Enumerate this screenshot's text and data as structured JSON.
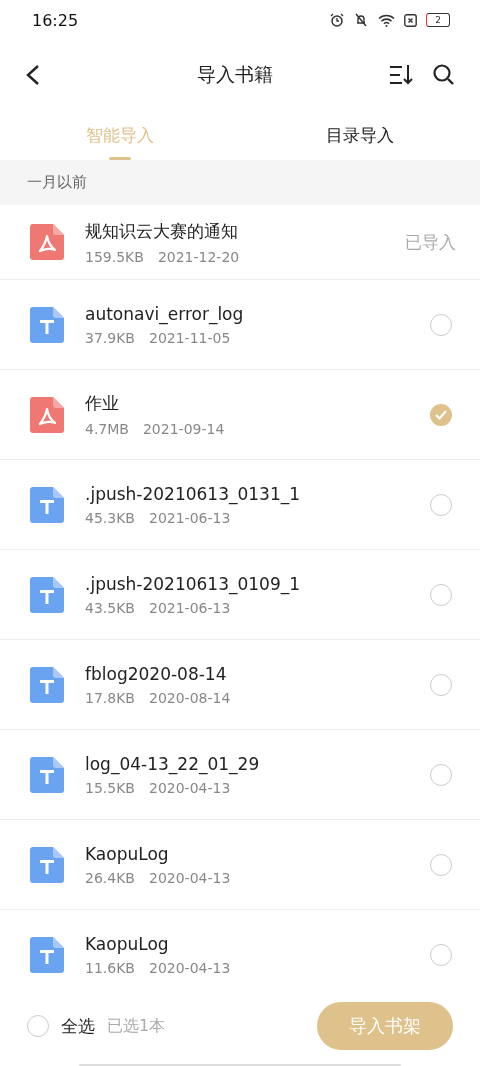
{
  "status_bar": {
    "time": "16:25",
    "battery": "2"
  },
  "header": {
    "title": "导入书籍"
  },
  "tabs": [
    {
      "label": "智能导入",
      "selected": true
    },
    {
      "label": "目录导入",
      "selected": false
    }
  ],
  "section": {
    "label": "一月以前"
  },
  "files": [
    {
      "kind": "pdf",
      "name": "规知识云大赛的通知",
      "size": "159.5KB",
      "date": "2021-12-20",
      "status": "已导入"
    },
    {
      "kind": "text",
      "name": "autonavi_error_log",
      "size": "37.9KB",
      "date": "2021-11-05",
      "selected": false
    },
    {
      "kind": "pdf",
      "name": "作业",
      "size": "4.7MB",
      "date": "2021-09-14",
      "selected": true
    },
    {
      "kind": "text",
      "name": ".jpush-20210613_0131_1",
      "size": "45.3KB",
      "date": "2021-06-13",
      "selected": false
    },
    {
      "kind": "text",
      "name": ".jpush-20210613_0109_1",
      "size": "43.5KB",
      "date": "2021-06-13",
      "selected": false
    },
    {
      "kind": "text",
      "name": "fblog2020-08-14",
      "size": "17.8KB",
      "date": "2020-08-14",
      "selected": false
    },
    {
      "kind": "text",
      "name": "log_04-13_22_01_29",
      "size": "15.5KB",
      "date": "2020-04-13",
      "selected": false
    },
    {
      "kind": "text",
      "name": "KaopuLog",
      "size": "26.4KB",
      "date": "2020-04-13",
      "selected": false
    },
    {
      "kind": "text",
      "name": "KaopuLog",
      "size": "11.6KB",
      "date": "2020-04-13",
      "selected": false
    }
  ],
  "footer": {
    "select_all": {
      "label": "全选",
      "checked": false
    },
    "count": "已选1本",
    "button": "导入书架"
  }
}
